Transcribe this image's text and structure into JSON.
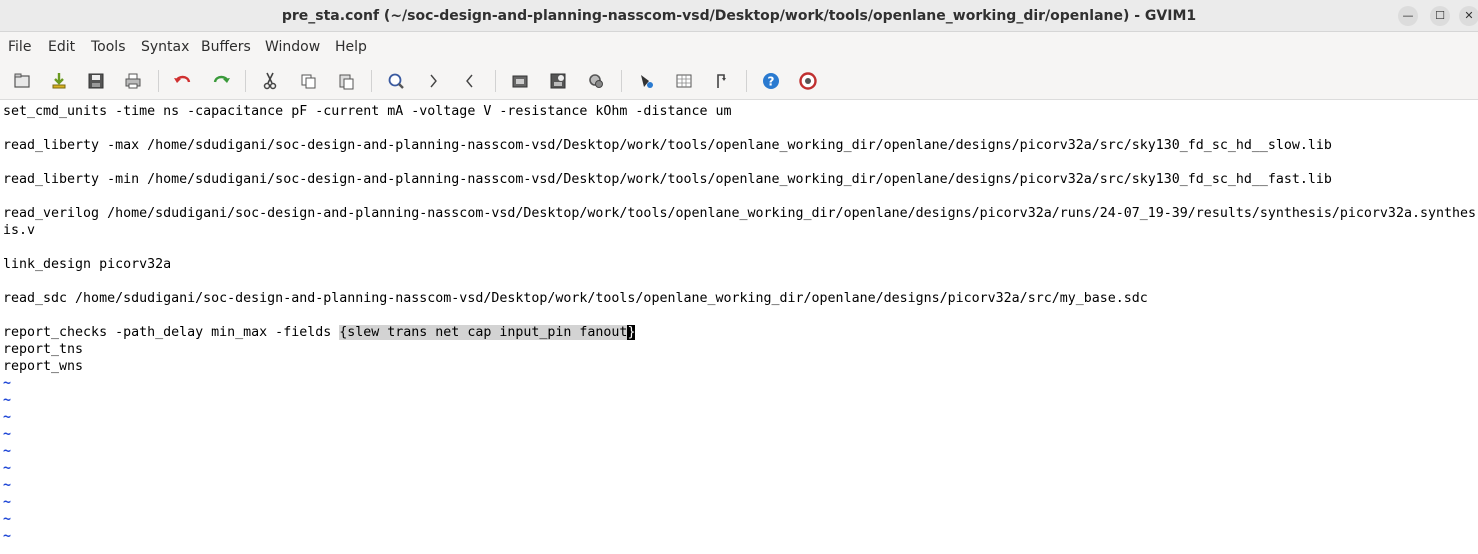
{
  "window": {
    "title": "pre_sta.conf (~/soc-design-and-planning-nasscom-vsd/Desktop/work/tools/openlane_working_dir/openlane) - GVIM1",
    "min_glyph": "—",
    "max_glyph": "☐",
    "close_glyph": "✕"
  },
  "menu": {
    "items": [
      {
        "label": "File"
      },
      {
        "label": "Edit"
      },
      {
        "label": "Tools"
      },
      {
        "label": "Syntax"
      },
      {
        "label": "Buffers"
      },
      {
        "label": "Window"
      },
      {
        "label": "Help"
      }
    ]
  },
  "toolbar": {
    "icons": [
      "open-file-icon",
      "load-session-icon",
      "save-icon",
      "print-icon",
      "undo-icon",
      "redo-icon",
      "cut-icon",
      "copy-icon",
      "paste-icon",
      "find-replace-icon",
      "find-next-icon",
      "find-prev-icon",
      "load-script-icon",
      "make-icon",
      "build-tags-icon",
      "run-shell-icon",
      "jump-tag-icon",
      "split-window-icon",
      "help-icon",
      "find-help-icon"
    ],
    "colors": {
      "undo": "#d03030",
      "redo": "#3a9a3a",
      "help": "#2a7ad0"
    }
  },
  "editor": {
    "lines": [
      "set_cmd_units -time ns -capacitance pF -current mA -voltage V -resistance kOhm -distance um",
      "",
      "read_liberty -max /home/sdudigani/soc-design-and-planning-nasscom-vsd/Desktop/work/tools/openlane_working_dir/openlane/designs/picorv32a/src/sky130_fd_sc_hd__slow.lib",
      "",
      "read_liberty -min /home/sdudigani/soc-design-and-planning-nasscom-vsd/Desktop/work/tools/openlane_working_dir/openlane/designs/picorv32a/src/sky130_fd_sc_hd__fast.lib",
      "",
      "read_verilog /home/sdudigani/soc-design-and-planning-nasscom-vsd/Desktop/work/tools/openlane_working_dir/openlane/designs/picorv32a/runs/24-07_19-39/results/synthesis/picorv32a.synthes",
      "is.v",
      "",
      "link_design picorv32a",
      "",
      "read_sdc /home/sdudigani/soc-design-and-planning-nasscom-vsd/Desktop/work/tools/openlane_working_dir/openlane/designs/picorv32a/src/my_base.sdc",
      "",
      "report_checks -path_delay min_max -fields ",
      "report_tns",
      "report_wns"
    ],
    "highlight_text": "{slew trans net cap input_pin fanout",
    "cursor_char": "}",
    "tilde": "~",
    "tilde_color": "#1f47d6"
  }
}
